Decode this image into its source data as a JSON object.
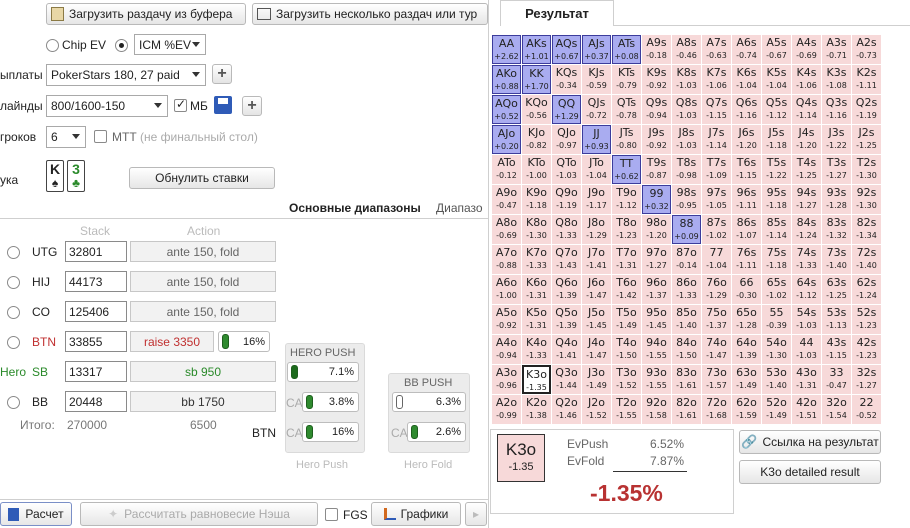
{
  "toolbar": {
    "load_buffer_label": "Загрузить раздачу из буфера",
    "load_multi_label": "Загрузить несколько раздач или тур"
  },
  "settings": {
    "mode_chip_ev": "Chip EV",
    "mode_icm": "ICM %EV",
    "payouts_label": "ыплаты",
    "payouts_value": "PokerStars 180, 27 paid",
    "blinds_label": "лайнды",
    "blinds_value": "800/1600-150",
    "mb_label": "МБ",
    "players_label": "гроков",
    "players_value": "6",
    "mtt_label": "MTT",
    "mtt_hint": "(не финальный стол)",
    "hand_label": "ука",
    "hand_card1": "K",
    "hand_card1_suit": "♠",
    "hand_card2": "3",
    "hand_card2_suit": "♣",
    "reset_bets_label": "Обнулить ставки"
  },
  "tabs": {
    "main_ranges": "Основные диапазоны",
    "ranges_cut": "Диапазо"
  },
  "seats_header": {
    "stack": "Stack",
    "action": "Action"
  },
  "seats": [
    {
      "name": "UTG",
      "stack": "32801",
      "action": "ante 150, fold"
    },
    {
      "name": "HIJ",
      "stack": "44173",
      "action": "ante 150, fold"
    },
    {
      "name": "CO",
      "stack": "125406",
      "action": "ante 150, fold"
    },
    {
      "name": "BTN",
      "stack": "33855",
      "action": "raise 3350",
      "range_pct": "16%"
    },
    {
      "name": "SB",
      "hero": "Hero",
      "stack": "13317",
      "action": "sb 950"
    },
    {
      "name": "BB",
      "stack": "20448",
      "action": "bb 1750"
    }
  ],
  "totals": {
    "label": "Итого:",
    "stack_total": "270000",
    "pot_total": "6500"
  },
  "hero_push": {
    "title": "HERO PUSH",
    "push_pct": "7.1%",
    "ca_label": "CA",
    "ca1_pct": "3.8%",
    "ca2_pct": "16%",
    "btn_label": "BTN",
    "footer": "Hero Push"
  },
  "bb_push": {
    "title": "BB PUSH",
    "push_pct": "6.3%",
    "ca_label": "CA",
    "ca_pct": "2.6%",
    "footer": "Hero Fold"
  },
  "bottom_bar": {
    "calc_label": "Расчет",
    "nash_label": "Рассчитать равновесие Нэша",
    "fgs_label": "FGS",
    "charts_label": "Графики"
  },
  "result": {
    "tab_label": "Результат",
    "grid": [
      [
        [
          "AA",
          "+2.62"
        ],
        [
          "AKs",
          "+1.01"
        ],
        [
          "AQs",
          "+0.67"
        ],
        [
          "AJs",
          "+0.37"
        ],
        [
          "ATs",
          "+0.08"
        ],
        [
          "A9s",
          "-0.18"
        ],
        [
          "A8s",
          "-0.46"
        ],
        [
          "A7s",
          "-0.63"
        ],
        [
          "A6s",
          "-0.74"
        ],
        [
          "A5s",
          "-0.67"
        ],
        [
          "A4s",
          "-0.69"
        ],
        [
          "A3s",
          "-0.71"
        ],
        [
          "A2s",
          "-0.73"
        ]
      ],
      [
        [
          "AKo",
          "+0.88"
        ],
        [
          "KK",
          "+1.70"
        ],
        [
          "KQs",
          "-0.34"
        ],
        [
          "KJs",
          "-0.59"
        ],
        [
          "KTs",
          "-0.79"
        ],
        [
          "K9s",
          "-0.92"
        ],
        [
          "K8s",
          "-1.03"
        ],
        [
          "K7s",
          "-1.06"
        ],
        [
          "K6s",
          "-1.04"
        ],
        [
          "K5s",
          "-1.04"
        ],
        [
          "K4s",
          "-1.06"
        ],
        [
          "K3s",
          "-1.08"
        ],
        [
          "K2s",
          "-1.11"
        ]
      ],
      [
        [
          "AQo",
          "+0.52"
        ],
        [
          "KQo",
          "-0.56"
        ],
        [
          "QQ",
          "+1.29"
        ],
        [
          "QJs",
          "-0.72"
        ],
        [
          "QTs",
          "-0.78"
        ],
        [
          "Q9s",
          "-0.94"
        ],
        [
          "Q8s",
          "-1.03"
        ],
        [
          "Q7s",
          "-1.15"
        ],
        [
          "Q6s",
          "-1.16"
        ],
        [
          "Q5s",
          "-1.12"
        ],
        [
          "Q4s",
          "-1.14"
        ],
        [
          "Q3s",
          "-1.16"
        ],
        [
          "Q2s",
          "-1.19"
        ]
      ],
      [
        [
          "AJo",
          "+0.20"
        ],
        [
          "KJo",
          "-0.82"
        ],
        [
          "QJo",
          "-0.97"
        ],
        [
          "JJ",
          "+0.93"
        ],
        [
          "JTs",
          "-0.80"
        ],
        [
          "J9s",
          "-0.92"
        ],
        [
          "J8s",
          "-1.03"
        ],
        [
          "J7s",
          "-1.14"
        ],
        [
          "J6s",
          "-1.20"
        ],
        [
          "J5s",
          "-1.18"
        ],
        [
          "J4s",
          "-1.20"
        ],
        [
          "J3s",
          "-1.22"
        ],
        [
          "J2s",
          "-1.25"
        ]
      ],
      [
        [
          "ATo",
          "-0.12"
        ],
        [
          "KTo",
          "-1.00"
        ],
        [
          "QTo",
          "-1.03"
        ],
        [
          "JTo",
          "-1.04"
        ],
        [
          "TT",
          "+0.62"
        ],
        [
          "T9s",
          "-0.87"
        ],
        [
          "T8s",
          "-0.98"
        ],
        [
          "T7s",
          "-1.09"
        ],
        [
          "T6s",
          "-1.15"
        ],
        [
          "T5s",
          "-1.22"
        ],
        [
          "T4s",
          "-1.25"
        ],
        [
          "T3s",
          "-1.27"
        ],
        [
          "T2s",
          "-1.30"
        ]
      ],
      [
        [
          "A9o",
          "-0.47"
        ],
        [
          "K9o",
          "-1.18"
        ],
        [
          "Q9o",
          "-1.19"
        ],
        [
          "J9o",
          "-1.17"
        ],
        [
          "T9o",
          "-1.12"
        ],
        [
          "99",
          "+0.32"
        ],
        [
          "98s",
          "-0.95"
        ],
        [
          "97s",
          "-1.05"
        ],
        [
          "96s",
          "-1.11"
        ],
        [
          "95s",
          "-1.18"
        ],
        [
          "94s",
          "-1.27"
        ],
        [
          "93s",
          "-1.28"
        ],
        [
          "92s",
          "-1.30"
        ]
      ],
      [
        [
          "A8o",
          "-0.69"
        ],
        [
          "K8o",
          "-1.30"
        ],
        [
          "Q8o",
          "-1.33"
        ],
        [
          "J8o",
          "-1.29"
        ],
        [
          "T8o",
          "-1.23"
        ],
        [
          "98o",
          "-1.20"
        ],
        [
          "88",
          "+0.09"
        ],
        [
          "87s",
          "-1.02"
        ],
        [
          "86s",
          "-1.07"
        ],
        [
          "85s",
          "-1.14"
        ],
        [
          "84s",
          "-1.24"
        ],
        [
          "83s",
          "-1.32"
        ],
        [
          "82s",
          "-1.34"
        ]
      ],
      [
        [
          "A7o",
          "-0.88"
        ],
        [
          "K7o",
          "-1.33"
        ],
        [
          "Q7o",
          "-1.43"
        ],
        [
          "J7o",
          "-1.41"
        ],
        [
          "T7o",
          "-1.31"
        ],
        [
          "97o",
          "-1.27"
        ],
        [
          "87o",
          "-0.14"
        ],
        [
          "77",
          "-1.04"
        ],
        [
          "76s",
          "-1.11"
        ],
        [
          "75s",
          "-1.18"
        ],
        [
          "74s",
          "-1.33"
        ],
        [
          "73s",
          "-1.40"
        ],
        [
          "72s",
          "-1.40"
        ]
      ],
      [
        [
          "A6o",
          "-1.00"
        ],
        [
          "K6o",
          "-1.31"
        ],
        [
          "Q6o",
          "-1.39"
        ],
        [
          "J6o",
          "-1.47"
        ],
        [
          "T6o",
          "-1.42"
        ],
        [
          "96o",
          "-1.37"
        ],
        [
          "86o",
          "-1.33"
        ],
        [
          "76o",
          "-1.29"
        ],
        [
          "66",
          "-0.30"
        ],
        [
          "65s",
          "-1.02"
        ],
        [
          "64s",
          "-1.12"
        ],
        [
          "63s",
          "-1.25"
        ],
        [
          "62s",
          "-1.24"
        ]
      ],
      [
        [
          "A5o",
          "-0.92"
        ],
        [
          "K5o",
          "-1.31"
        ],
        [
          "Q5o",
          "-1.39"
        ],
        [
          "J5o",
          "-1.45"
        ],
        [
          "T5o",
          "-1.49"
        ],
        [
          "95o",
          "-1.45"
        ],
        [
          "85o",
          "-1.40"
        ],
        [
          "75o",
          "-1.37"
        ],
        [
          "65o",
          "-1.28"
        ],
        [
          "55",
          "-0.39"
        ],
        [
          "54s",
          "-1.03"
        ],
        [
          "53s",
          "-1.13"
        ],
        [
          "52s",
          "-1.23"
        ]
      ],
      [
        [
          "A4o",
          "-0.94"
        ],
        [
          "K4o",
          "-1.33"
        ],
        [
          "Q4o",
          "-1.41"
        ],
        [
          "J4o",
          "-1.47"
        ],
        [
          "T4o",
          "-1.50"
        ],
        [
          "94o",
          "-1.55"
        ],
        [
          "84o",
          "-1.50"
        ],
        [
          "74o",
          "-1.47"
        ],
        [
          "64o",
          "-1.39"
        ],
        [
          "54o",
          "-1.30"
        ],
        [
          "44",
          "-1.03"
        ],
        [
          "43s",
          "-1.15"
        ],
        [
          "42s",
          "-1.23"
        ]
      ],
      [
        [
          "A3o",
          "-0.96"
        ],
        [
          "K3o",
          "-1.35"
        ],
        [
          "Q3o",
          "-1.44"
        ],
        [
          "J3o",
          "-1.49"
        ],
        [
          "T3o",
          "-1.52"
        ],
        [
          "93o",
          "-1.55"
        ],
        [
          "83o",
          "-1.61"
        ],
        [
          "73o",
          "-1.57"
        ],
        [
          "63o",
          "-1.49"
        ],
        [
          "53o",
          "-1.40"
        ],
        [
          "43o",
          "-1.31"
        ],
        [
          "33",
          "-0.47"
        ],
        [
          "32s",
          "-1.27"
        ]
      ],
      [
        [
          "A2o",
          "-0.99"
        ],
        [
          "K2o",
          "-1.38"
        ],
        [
          "Q2o",
          "-1.46"
        ],
        [
          "J2o",
          "-1.52"
        ],
        [
          "T2o",
          "-1.55"
        ],
        [
          "92o",
          "-1.58"
        ],
        [
          "82o",
          "-1.61"
        ],
        [
          "72o",
          "-1.68"
        ],
        [
          "62o",
          "-1.59"
        ],
        [
          "52o",
          "-1.49"
        ],
        [
          "42o",
          "-1.51"
        ],
        [
          "32o",
          "-1.54"
        ],
        [
          "22",
          "-0.52"
        ]
      ]
    ],
    "detail": {
      "hand": "K3o",
      "hand_value": "-1.35",
      "ev_push_label": "EvPush",
      "ev_push_value": "6.52%",
      "ev_fold_label": "EvFold",
      "ev_fold_value": "7.87%",
      "diff_value": "-1.35%",
      "link_label": "Ссылка на результат",
      "detailed_label": "K3o detailed result"
    },
    "colors": {
      "negative": "#f7d9d9",
      "positive": "#a9acf0",
      "diff": "#b83232"
    }
  }
}
